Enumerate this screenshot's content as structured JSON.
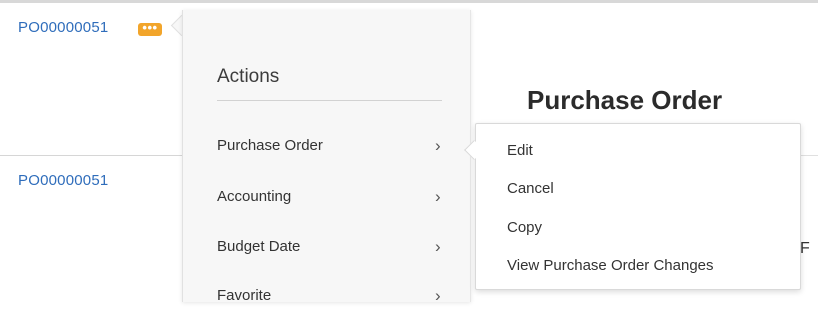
{
  "rows": [
    {
      "po_number": "PO00000051",
      "has_actions_button": true
    },
    {
      "po_number": "PO00000051",
      "has_actions_button": false
    }
  ],
  "more_button": {
    "icon": "ellipsis-icon",
    "color": "#f2a52b"
  },
  "background": {
    "page_title": "Purchase Order",
    "clipped_text": "F"
  },
  "actions_menu": {
    "title": "Actions",
    "items": [
      {
        "label": "Purchase Order",
        "icon": "chevron-right-icon",
        "glyph": "›"
      },
      {
        "label": "Accounting",
        "icon": "chevron-right-icon",
        "glyph": "›"
      },
      {
        "label": "Budget Date",
        "icon": "chevron-right-icon",
        "glyph": "›"
      },
      {
        "label": "Favorite",
        "icon": "chevron-right-icon",
        "glyph": "›"
      }
    ]
  },
  "submenu": {
    "items": [
      {
        "label": "Edit"
      },
      {
        "label": "Cancel"
      },
      {
        "label": "Copy"
      },
      {
        "label": "View Purchase Order Changes"
      }
    ]
  },
  "colors": {
    "link": "#2f6dbb",
    "accent": "#f2a52b",
    "panel_bg": "#f7f7f7"
  }
}
